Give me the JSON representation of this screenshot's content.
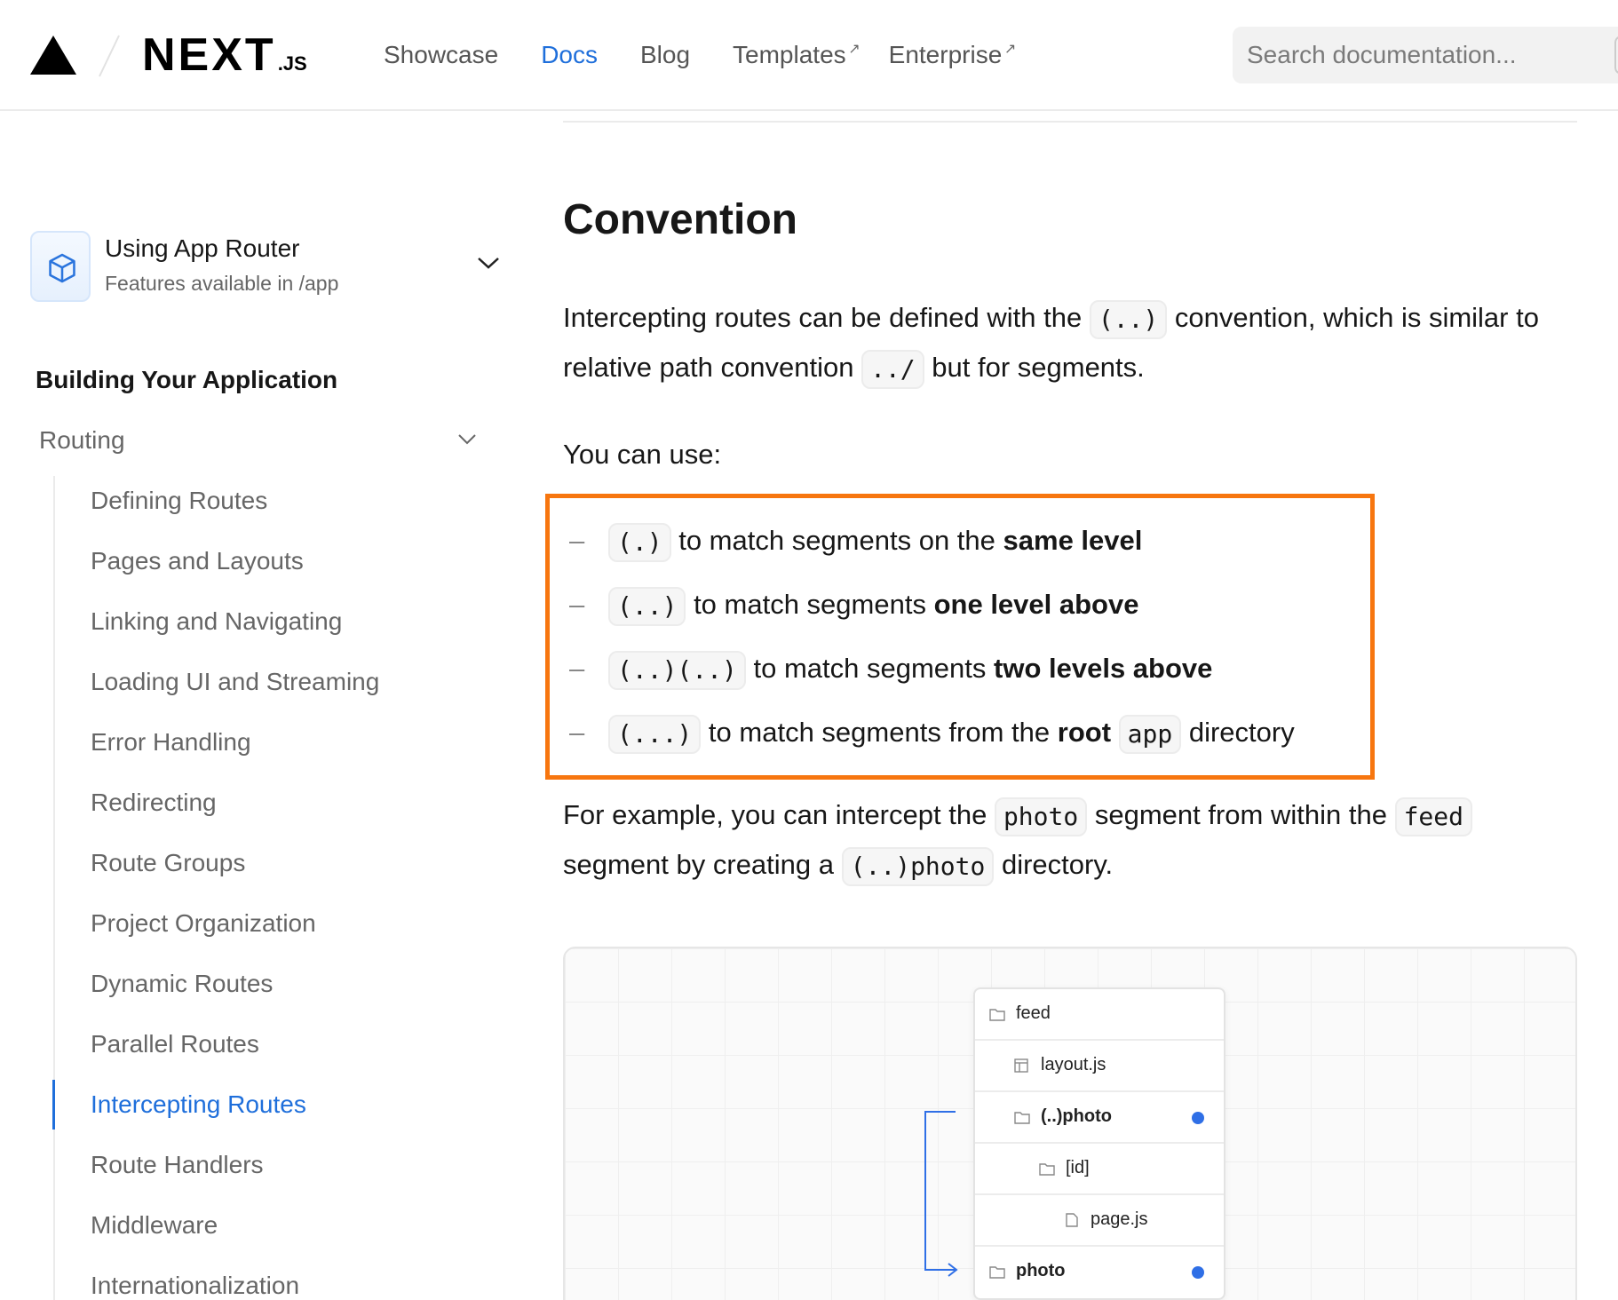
{
  "header": {
    "logo_text": "NEXT",
    "logo_suffix": ".JS",
    "nav": [
      {
        "label": "Showcase",
        "active": false,
        "external": false
      },
      {
        "label": "Docs",
        "active": true,
        "external": false
      },
      {
        "label": "Blog",
        "active": false,
        "external": false
      },
      {
        "label": "Templates",
        "active": false,
        "external": true
      },
      {
        "label": "Enterprise",
        "active": false,
        "external": true
      }
    ],
    "external_glyph": "↗",
    "search_placeholder": "Search documentation..."
  },
  "sidebar": {
    "router_title": "Using App Router",
    "router_subtitle": "Features available in /app",
    "section_title": "Building Your Application",
    "group": "Routing",
    "items": [
      {
        "label": "Defining Routes",
        "active": false
      },
      {
        "label": "Pages and Layouts",
        "active": false
      },
      {
        "label": "Linking and Navigating",
        "active": false
      },
      {
        "label": "Loading UI and Streaming",
        "active": false
      },
      {
        "label": "Error Handling",
        "active": false
      },
      {
        "label": "Redirecting",
        "active": false
      },
      {
        "label": "Route Groups",
        "active": false
      },
      {
        "label": "Project Organization",
        "active": false
      },
      {
        "label": "Dynamic Routes",
        "active": false
      },
      {
        "label": "Parallel Routes",
        "active": false
      },
      {
        "label": "Intercepting Routes",
        "active": true
      },
      {
        "label": "Route Handlers",
        "active": false
      },
      {
        "label": "Middleware",
        "active": false
      },
      {
        "label": "Internationalization",
        "active": false
      }
    ]
  },
  "main": {
    "heading": "Convention",
    "intro": {
      "t1": "Intercepting routes can be defined with the",
      "c1": "(..)",
      "t2": "convention, which is similar to relative path convention",
      "c2": "../",
      "t3": "but for segments."
    },
    "you_can_use": "You can use:",
    "bullets": [
      {
        "code": "(.)",
        "text": "to match segments on the",
        "bold": "same level",
        "code2": "",
        "tail": ""
      },
      {
        "code": "(..)",
        "text": "to match segments",
        "bold": "one level above",
        "code2": "",
        "tail": ""
      },
      {
        "code": "(..)(..)",
        "text": "to match segments",
        "bold": "two levels above",
        "code2": "",
        "tail": ""
      },
      {
        "code": "(...)",
        "text": "to match segments from the",
        "bold": "root",
        "code2": "app",
        "tail": "directory"
      }
    ],
    "bullet_dash": "–",
    "example": {
      "t1": "For example, you can intercept the",
      "c1": "photo",
      "t2": "segment from within the",
      "c2": "feed",
      "t3": "segment by creating a",
      "c3": "(..)photo",
      "t4": "directory."
    },
    "diagram": {
      "rows": [
        {
          "label": "feed",
          "icon": "folder-icon",
          "indent": 0,
          "bold": false,
          "dot": false
        },
        {
          "label": "layout.js",
          "icon": "layout-file-icon",
          "indent": 1,
          "bold": false,
          "dot": false
        },
        {
          "label": "(..)photo",
          "icon": "folder-icon",
          "indent": 1,
          "bold": true,
          "dot": true
        },
        {
          "label": "[id]",
          "icon": "folder-icon",
          "indent": 2,
          "bold": false,
          "dot": false
        },
        {
          "label": "page.js",
          "icon": "file-icon",
          "indent": 3,
          "bold": false,
          "dot": false
        },
        {
          "label": "photo",
          "icon": "folder-icon",
          "indent": 0,
          "bold": true,
          "dot": true
        }
      ],
      "dot_color": "#2f6fe6",
      "arrow_color": "#2f6fe6"
    }
  },
  "colors": {
    "accent": "#1f6fdb",
    "highlight_border": "#f7760f"
  }
}
